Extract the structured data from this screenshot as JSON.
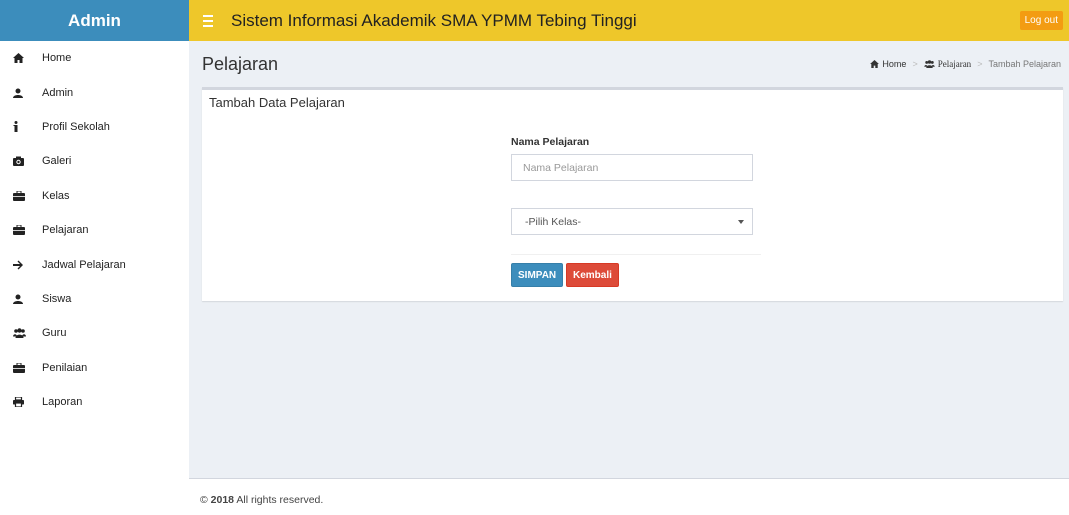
{
  "brand": {
    "label": "Admin"
  },
  "header": {
    "title": "Sistem Informasi Akademik SMA YPMM Tebing Tinggi",
    "logout_label": "Log out",
    "menu_icon": "hamburger-icon"
  },
  "sidebar": {
    "items": [
      {
        "label": "Home",
        "icon": "home-icon"
      },
      {
        "label": "Admin",
        "icon": "user-icon"
      },
      {
        "label": "Profil Sekolah",
        "icon": "info-icon"
      },
      {
        "label": "Galeri",
        "icon": "camera-icon"
      },
      {
        "label": "Kelas",
        "icon": "briefcase-icon"
      },
      {
        "label": "Pelajaran",
        "icon": "briefcase-icon"
      },
      {
        "label": "Jadwal Pelajaran",
        "icon": "arrow-right-icon"
      },
      {
        "label": "Siswa",
        "icon": "user-icon"
      },
      {
        "label": "Guru",
        "icon": "users-icon"
      },
      {
        "label": "Penilaian",
        "icon": "briefcase-icon"
      },
      {
        "label": "Laporan",
        "icon": "printer-icon"
      }
    ]
  },
  "page": {
    "title": "Pelajaran",
    "breadcrumb": [
      {
        "label": "Home",
        "icon": "home-icon"
      },
      {
        "label": "Pelajaran",
        "icon": "users-icon"
      },
      {
        "label": "Tambah Pelajaran"
      }
    ]
  },
  "form": {
    "box_title": "Tambah Data Pelajaran",
    "nama_label": "Nama Pelajaran",
    "nama_placeholder": "Nama Pelajaran",
    "nama_value": "",
    "kelas_selected": "-Pilih Kelas-",
    "save_label": "SIMPAN",
    "back_label": "Kembali"
  },
  "footer": {
    "year": "2018",
    "text": "All rights reserved."
  },
  "colors": {
    "brand": "#3c8dbc",
    "topbar": "#eec72a",
    "logout": "#f39c12",
    "primary": "#3c8dbc",
    "danger": "#dd4b39",
    "content_bg": "#ecf0f5"
  }
}
